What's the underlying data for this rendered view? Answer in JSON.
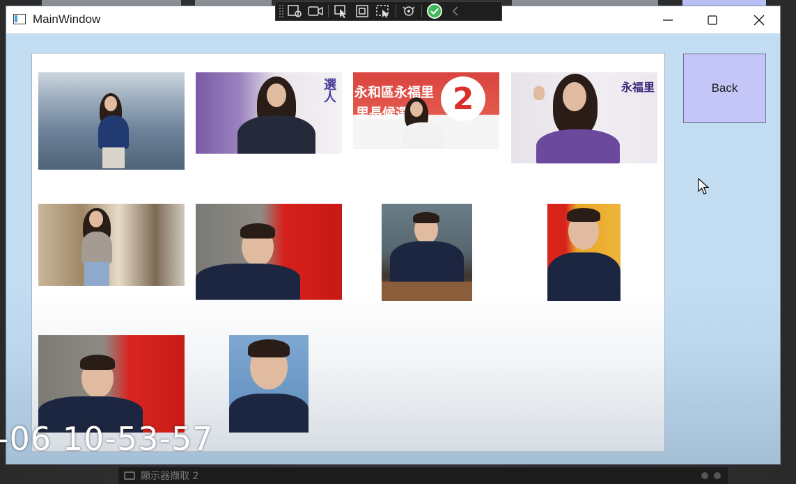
{
  "window": {
    "title": "MainWindow",
    "controls": [
      "minimize-icon",
      "maximize-icon",
      "close-icon"
    ]
  },
  "debug_toolbar": {
    "buttons": [
      "live-visual-tree-icon",
      "record-icon",
      "select-element-icon",
      "display-layout-adorners-icon",
      "track-focused-element-icon",
      "hot-reload-icon",
      "hot-reload-status-check-icon",
      "collapse-chevron-icon"
    ]
  },
  "gallery": {
    "images": [
      {
        "name": "woman-beach-photo"
      },
      {
        "name": "woman-heart-gesture-campaign-photo",
        "text": "選人"
      },
      {
        "name": "campaign-banner-photo",
        "text": "永和區永福里",
        "subtext": "里長候選",
        "number": "2"
      },
      {
        "name": "woman-fist-campaign-photo",
        "text": "永福里"
      },
      {
        "name": "woman-storefront-photo"
      },
      {
        "name": "man-red-flag-photo-1"
      },
      {
        "name": "man-podium-photo"
      },
      {
        "name": "man-yellow-flag-photo"
      },
      {
        "name": "man-red-flag-photo-2"
      },
      {
        "name": "man-blue-portrait-photo"
      }
    ]
  },
  "back_button": {
    "label": "Back"
  },
  "overlay": {
    "timestamp": "-06 10-53-57"
  },
  "taskbar": {
    "label": "顯示器擷取 2"
  },
  "colors": {
    "window_bg": "#c3ddf3",
    "back_button_bg": "#c3c6f6",
    "toolbar_bg": "#1e1e1e",
    "check_green": "#3db85a"
  }
}
